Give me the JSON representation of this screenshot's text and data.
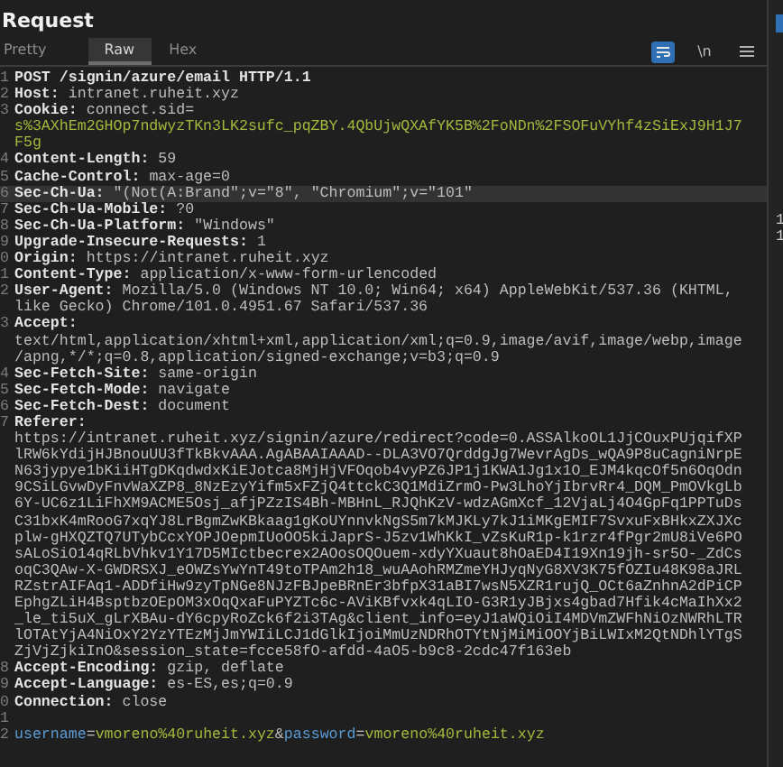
{
  "panel": {
    "title": "Request"
  },
  "tabs": [
    {
      "label": "Pretty",
      "selected": false
    },
    {
      "label": "Raw",
      "selected": true
    },
    {
      "label": "Hex",
      "selected": false
    }
  ],
  "toolbar": {
    "wrap_on": true,
    "newline_label": "\\n",
    "newline_on": false
  },
  "rows": [
    {
      "number": "1",
      "highlighted": false,
      "parts": [
        {
          "kind": "name",
          "text": "POST /signin/azure/email HTTP/1.1"
        }
      ]
    },
    {
      "number": "2",
      "highlighted": false,
      "parts": [
        {
          "kind": "name",
          "text": "Host: "
        },
        {
          "kind": "value",
          "text": "intranet.ruheit.xyz"
        }
      ]
    },
    {
      "number": "3",
      "highlighted": false,
      "parts": [
        {
          "kind": "name",
          "text": "Cookie: "
        },
        {
          "kind": "value",
          "text": "connect.sid="
        }
      ]
    },
    {
      "highlighted": false,
      "parts": [
        {
          "kind": "cookie",
          "text": "s%3AXhEm2GHOp7ndwyzTKn3LK2sufc_pqZBY.4QbUjwQXAfYK5B%2FoNDn%2FSOFuVYhf4zSiExJ9H1J7"
        }
      ]
    },
    {
      "highlighted": false,
      "parts": [
        {
          "kind": "cookie",
          "text": "F5g"
        }
      ]
    },
    {
      "number": "4",
      "highlighted": false,
      "parts": [
        {
          "kind": "name",
          "text": "Content-Length: "
        },
        {
          "kind": "value",
          "text": "59"
        }
      ]
    },
    {
      "number": "5",
      "highlighted": false,
      "parts": [
        {
          "kind": "name",
          "text": "Cache-Control: "
        },
        {
          "kind": "value",
          "text": "max-age=0"
        }
      ]
    },
    {
      "number": "6",
      "highlighted": true,
      "parts": [
        {
          "kind": "name",
          "text": "Sec-Ch-Ua: "
        },
        {
          "kind": "value",
          "text": "\"(Not(A:Brand\";v=\"8\", \"Chromium\";v=\"101\""
        }
      ]
    },
    {
      "number": "7",
      "highlighted": false,
      "parts": [
        {
          "kind": "name",
          "text": "Sec-Ch-Ua-Mobile: "
        },
        {
          "kind": "value",
          "text": "?0"
        }
      ]
    },
    {
      "number": "8",
      "highlighted": false,
      "parts": [
        {
          "kind": "name",
          "text": "Sec-Ch-Ua-Platform: "
        },
        {
          "kind": "value",
          "text": "\"Windows\""
        }
      ]
    },
    {
      "number": "9",
      "highlighted": false,
      "parts": [
        {
          "kind": "name",
          "text": "Upgrade-Insecure-Requests: "
        },
        {
          "kind": "value",
          "text": "1"
        }
      ]
    },
    {
      "number": "0",
      "highlighted": false,
      "parts": [
        {
          "kind": "name",
          "text": "Origin: "
        },
        {
          "kind": "value",
          "text": "https://intranet.ruheit.xyz"
        }
      ]
    },
    {
      "number": "1",
      "highlighted": false,
      "parts": [
        {
          "kind": "name",
          "text": "Content-Type: "
        },
        {
          "kind": "value",
          "text": "application/x-www-form-urlencoded"
        }
      ]
    },
    {
      "number": "2",
      "highlighted": false,
      "parts": [
        {
          "kind": "name",
          "text": "User-Agent: "
        },
        {
          "kind": "value",
          "text": "Mozilla/5.0 (Windows NT 10.0; Win64; x64) AppleWebKit/537.36 (KHTML,"
        }
      ]
    },
    {
      "highlighted": false,
      "parts": [
        {
          "kind": "value",
          "text": "like Gecko) Chrome/101.0.4951.67 Safari/537.36"
        }
      ]
    },
    {
      "number": "3",
      "highlighted": false,
      "parts": [
        {
          "kind": "name",
          "text": "Accept:"
        }
      ]
    },
    {
      "highlighted": false,
      "parts": [
        {
          "kind": "value",
          "text": "text/html,application/xhtml+xml,application/xml;q=0.9,image/avif,image/webp,image"
        }
      ]
    },
    {
      "highlighted": false,
      "parts": [
        {
          "kind": "value",
          "text": "/apng,*/*;q=0.8,application/signed-exchange;v=b3;q=0.9"
        }
      ]
    },
    {
      "number": "4",
      "highlighted": false,
      "parts": [
        {
          "kind": "name",
          "text": "Sec-Fetch-Site: "
        },
        {
          "kind": "value",
          "text": "same-origin"
        }
      ]
    },
    {
      "number": "5",
      "highlighted": false,
      "parts": [
        {
          "kind": "name",
          "text": "Sec-Fetch-Mode: "
        },
        {
          "kind": "value",
          "text": "navigate"
        }
      ]
    },
    {
      "number": "6",
      "highlighted": false,
      "parts": [
        {
          "kind": "name",
          "text": "Sec-Fetch-Dest: "
        },
        {
          "kind": "value",
          "text": "document"
        }
      ]
    },
    {
      "number": "7",
      "highlighted": false,
      "parts": [
        {
          "kind": "name",
          "text": "Referer:"
        }
      ]
    },
    {
      "highlighted": false,
      "parts": [
        {
          "kind": "value",
          "text": "https://intranet.ruheit.xyz/signin/azure/redirect?code=0.ASSAlkoOL1JjCOuxPUjqifXP"
        }
      ]
    },
    {
      "highlighted": false,
      "parts": [
        {
          "kind": "value",
          "text": "lRW6kYdijHJBnouUU3fTkBkvAAA.AgABAAIAAAD--DLA3VO7QrddgJg7WevrAgDs_wQA9P8uCagniNrpE"
        }
      ]
    },
    {
      "highlighted": false,
      "parts": [
        {
          "kind": "value",
          "text": "N63jypye1bKiiHTgDKqdwdxKiEJotca8MjHjVFOqob4vyPZ6JP1j1KWA1Jg1x1O_EJM4kqcOf5n6OqOdn"
        }
      ]
    },
    {
      "highlighted": false,
      "parts": [
        {
          "kind": "value",
          "text": "9CSiLGvwDyFnvWaXZP8_8NzEzyYifm5xFZjQ4ttckC3Q1MdiZrmO-Pw3LhoYjIbrvRr4_DQM_PmOVkgLb"
        }
      ]
    },
    {
      "highlighted": false,
      "parts": [
        {
          "kind": "value",
          "text": "6Y-UC6z1LiFhXM9ACME5Osj_afjPZzIS4Bh-MBHnL_RJQhKzV-wdzAGmXcf_12VjaLj4O4GpFq1PPTuDs"
        }
      ]
    },
    {
      "highlighted": false,
      "parts": [
        {
          "kind": "value",
          "text": "C31bxK4mRooG7xqYJ8LrBgmZwKBkaag1gKoUYnnvkNgS5m7kMJKLy7kJ1iMKgEMIF7SvxuFxBHkxZXJXc"
        }
      ]
    },
    {
      "highlighted": false,
      "parts": [
        {
          "kind": "value",
          "text": "plw-gHXQZTQ7UTybCcxYOPJOepmIUoOO5kiJaprS-J5zv1WhKkI_vZsKuR1p-k1rzr4fPgr2mU8iVe6PO"
        }
      ]
    },
    {
      "highlighted": false,
      "parts": [
        {
          "kind": "value",
          "text": "sALoSiO14qRLbVhkv1Y17D5MIctbecrex2AOosOQOuem-xdyYXuaut8hOaED4I19Xn19jh-sr5O-_ZdCs"
        }
      ]
    },
    {
      "highlighted": false,
      "parts": [
        {
          "kind": "value",
          "text": "oqC3QAw-X-GWDRSXJ_eOWZsYwYnT49toTPAm2h18_wuAAohRMZmeYHJyqNyG8XV3K75fOZIu48K98aJRL"
        }
      ]
    },
    {
      "highlighted": false,
      "parts": [
        {
          "kind": "value",
          "text": "RZstrAIFAq1-ADDfiHw9zyTpNGe8NJzFBJpeBRnEr3bfpX31aBI7wsN5XZR1rujQ_OCt6aZnhnA2dPiCP"
        }
      ]
    },
    {
      "highlighted": false,
      "parts": [
        {
          "kind": "value",
          "text": "EphgZLiH4BsptbzOEpOM3xOqQxaFuPYZTc6c-AViKBfvxk4qLIO-G3R1yJBjxs4gbad7Hfik4cMaIhXx2"
        }
      ]
    },
    {
      "highlighted": false,
      "parts": [
        {
          "kind": "value",
          "text": "_le_ti5uX_gLrXBAu-dY6cpyRoZck6f2i3TAg&client_info=eyJ1aWQiOiI4MDVmZWFhNiOzNWRhLTR"
        }
      ]
    },
    {
      "highlighted": false,
      "parts": [
        {
          "kind": "value",
          "text": "lOTAtYjA4NiOxY2YzYTEzMjJmYWIiLCJ1dGlkIjoiMmUzNDRhOTYtNjMiMiOOYjBiLWIxM2QtNDhlYTgS"
        }
      ]
    },
    {
      "highlighted": false,
      "parts": [
        {
          "kind": "value",
          "text": "ZjVjZjkiInO&session_state=fcce58fO-afdd-4aO5-b9c8-2cdc47f163eb"
        }
      ]
    },
    {
      "number": "8",
      "highlighted": false,
      "parts": [
        {
          "kind": "name",
          "text": "Accept-Encoding: "
        },
        {
          "kind": "value",
          "text": "gzip, deflate"
        }
      ]
    },
    {
      "number": "9",
      "highlighted": false,
      "parts": [
        {
          "kind": "name",
          "text": "Accept-Language: "
        },
        {
          "kind": "value",
          "text": "es-ES,es;q=0.9"
        }
      ]
    },
    {
      "number": "0",
      "highlighted": false,
      "parts": [
        {
          "kind": "name",
          "text": "Connection: "
        },
        {
          "kind": "value",
          "text": "close"
        }
      ]
    },
    {
      "number": "1",
      "highlighted": false,
      "parts": []
    },
    {
      "number": "2",
      "highlighted": false,
      "parts": [
        {
          "kind": "param",
          "text": "username"
        },
        {
          "kind": "value",
          "text": "="
        },
        {
          "kind": "cookie",
          "text": "vmoreno%40ruheit.xyz"
        },
        {
          "kind": "value",
          "text": "&"
        },
        {
          "kind": "param",
          "text": "password"
        },
        {
          "kind": "value",
          "text": "="
        },
        {
          "kind": "cookie",
          "text": "vmoreno%40ruheit.xyz"
        }
      ]
    }
  ],
  "side_panel": {
    "lines": [
      "1",
      "1"
    ]
  }
}
